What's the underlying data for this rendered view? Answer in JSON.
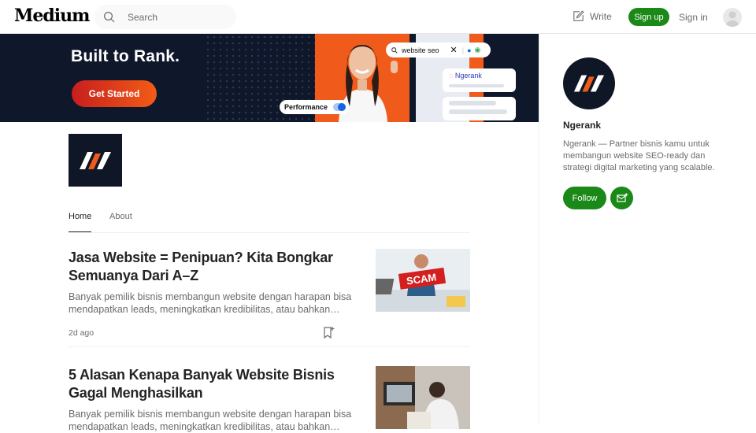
{
  "header": {
    "logo": "Medium",
    "search_placeholder": "Search",
    "write_label": "Write",
    "signup_label": "Sign up",
    "signin_label": "Sign in"
  },
  "banner": {
    "title": "Built to Rank.",
    "cta_label": "Get Started",
    "search_query": "website seo",
    "result_label": "Ngerank",
    "toggle_label": "Performance"
  },
  "tabs": [
    {
      "label": "Home",
      "active": true
    },
    {
      "label": "About",
      "active": false
    }
  ],
  "articles": [
    {
      "title": "Jasa Website = Penipuan? Kita Bongkar Semuanya Dari A–Z",
      "excerpt": "Banyak pemilik bisnis membangun website dengan harapan bisa mendapatkan leads, meningkatkan kredibilitas, atau bahkan…",
      "date": "2d ago",
      "thumb_text": "SCAM"
    },
    {
      "title": "5 Alasan Kenapa Banyak Website Bisnis Gagal Menghasilkan",
      "excerpt": "Banyak pemilik bisnis membangun website dengan harapan bisa mendapatkan leads, meningkatkan kredibilitas, atau bahkan…"
    }
  ],
  "sidebar": {
    "name": "Ngerank",
    "description": "Ngerank — Partner bisnis kamu untuk membangun website SEO-ready dan strategi digital marketing yang scalable.",
    "follow_label": "Follow"
  },
  "colors": {
    "brand_green": "#1a8917",
    "banner_navy": "#0f172a",
    "accent_orange": "#f05a1a"
  }
}
